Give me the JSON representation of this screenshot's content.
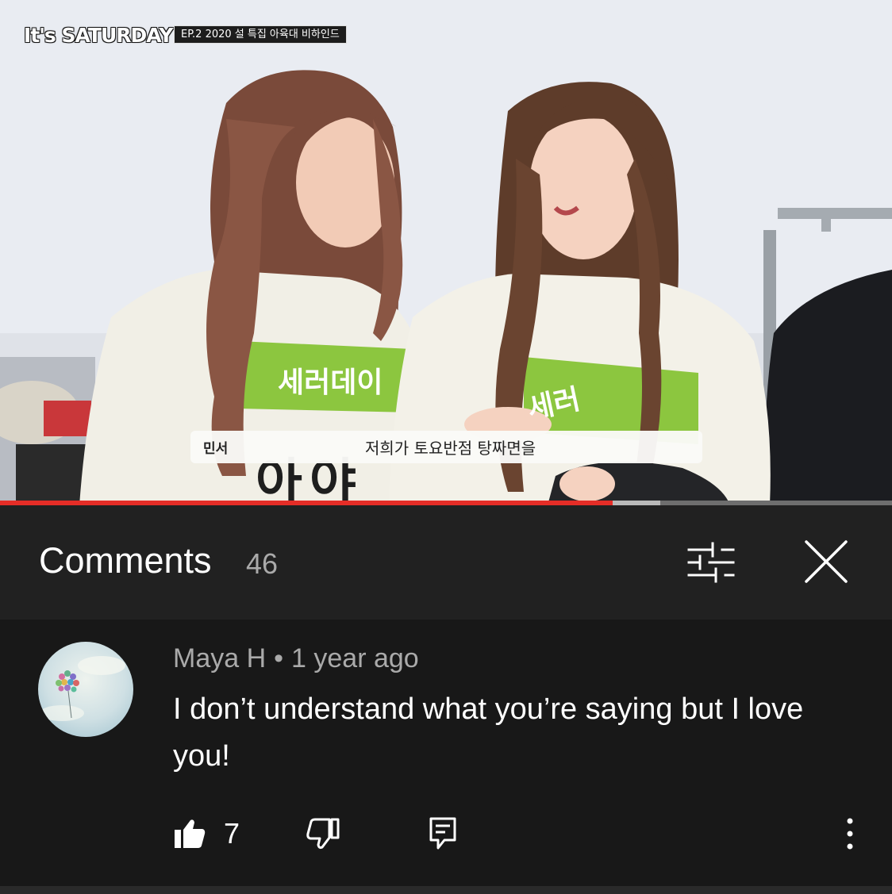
{
  "video": {
    "brand": "It's SATURDAY",
    "episode_badge": "EP.2 2020 설 특집 아육대 비하인드",
    "subtitle_speaker": "민서",
    "subtitle_text": "저희가 토요반점 탕짜면을",
    "shirt_text": "세러데이",
    "progress_fraction": 0.687,
    "buffered_fraction": 0.74,
    "progress_color": "#e52d27"
  },
  "comments": {
    "title": "Comments",
    "count": "46",
    "sort_icon": "sliders-icon",
    "close_icon": "close-icon"
  },
  "comment": {
    "author": "Maya H",
    "separator": "•",
    "time": "1 year ago",
    "text": "I don’t understand what you’re saying but I love you!",
    "likes": "7",
    "actions": [
      "thumb-up-icon",
      "thumb-down-icon",
      "reply-icon",
      "more-vert-icon"
    ]
  },
  "colors": {
    "background": "#212121",
    "comment_background": "#181818",
    "secondary_text": "#aaaaaa"
  }
}
